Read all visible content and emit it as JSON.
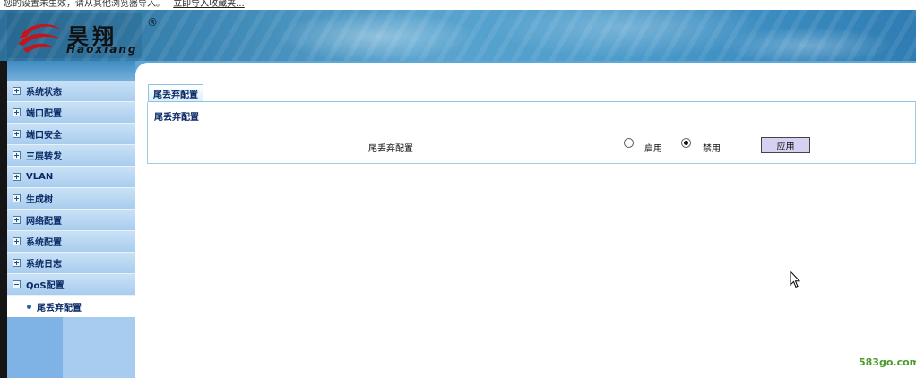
{
  "notice": {
    "text": "您的设置未生效，请从其他浏览器导入。",
    "link": "立即导入收藏夹..."
  },
  "brand": {
    "name_cn": "昊翔",
    "name_en": "Haoxiang",
    "registered": "®"
  },
  "sidebar": {
    "items": [
      {
        "label": "系统状态",
        "icon": "plus-box-icon"
      },
      {
        "label": "端口配置",
        "icon": "plus-box-icon"
      },
      {
        "label": "端口安全",
        "icon": "plus-box-icon"
      },
      {
        "label": "三层转发",
        "icon": "plus-box-icon"
      },
      {
        "label": "VLAN",
        "icon": "plus-box-icon"
      },
      {
        "label": "生成树",
        "icon": "plus-box-icon"
      },
      {
        "label": "网络配置",
        "icon": "plus-box-icon"
      },
      {
        "label": "系统配置",
        "icon": "plus-box-icon"
      },
      {
        "label": "系统日志",
        "icon": "plus-box-icon"
      },
      {
        "label": "QoS配置",
        "icon": "minus-box-icon"
      }
    ],
    "subitem": {
      "label": "尾丢弃配置",
      "icon": "bullet-icon"
    }
  },
  "main": {
    "tab": "尾丢弃配置",
    "panel_title": "尾丢弃配置",
    "row_label": "尾丢弃配置",
    "radio_enable": "启用",
    "radio_disable": "禁用",
    "selected": "禁用",
    "apply": "应用"
  },
  "watermark": "583go.com",
  "colors": {
    "sidebar_bg": "#b5d5f2",
    "menu_text": "#0a2a66",
    "header_blue": "#3b86b4",
    "apply_button": "#d7d1f1"
  }
}
